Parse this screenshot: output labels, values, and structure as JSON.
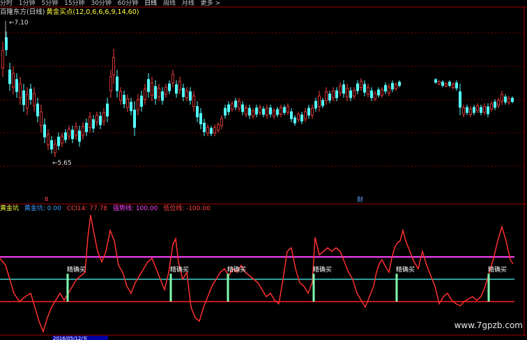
{
  "tabs": [
    "分时",
    "1分钟",
    "5分钟",
    "15分钟",
    "30分钟",
    "60分钟",
    "日线",
    "周线",
    "月线",
    "更多 >"
  ],
  "active_tab": "日线",
  "title": {
    "stock": "百隆东方(日线)",
    "indicator": "黄金买点(12,0,6,6,6,9,14,60)"
  },
  "price_high": "7.10",
  "price_low": "5.65",
  "event_markers": {
    "left": "B",
    "right": "财"
  },
  "indicator_bar": {
    "name": "黄金坑",
    "items": [
      {
        "label": "黄金坑: 0.00",
        "color": "#40a0ff"
      },
      {
        "label": "CCI14: 77.78",
        "color": "#ff4040"
      },
      {
        "label": "强势线: 100.00",
        "color": "#ff40ff"
      },
      {
        "label": "低位线: -100.00",
        "color": "#ff4040"
      }
    ]
  },
  "signal_label": "精确买",
  "watermark": "www.7gpzb.com",
  "date_label": "2016/05/12/五",
  "colors": {
    "up": "#ff4040",
    "down": "#54ffff",
    "strong": "#ff40ff",
    "weak": "#ff2020",
    "mid": "#40d0d0",
    "signal": "#80ffb0"
  }
}
